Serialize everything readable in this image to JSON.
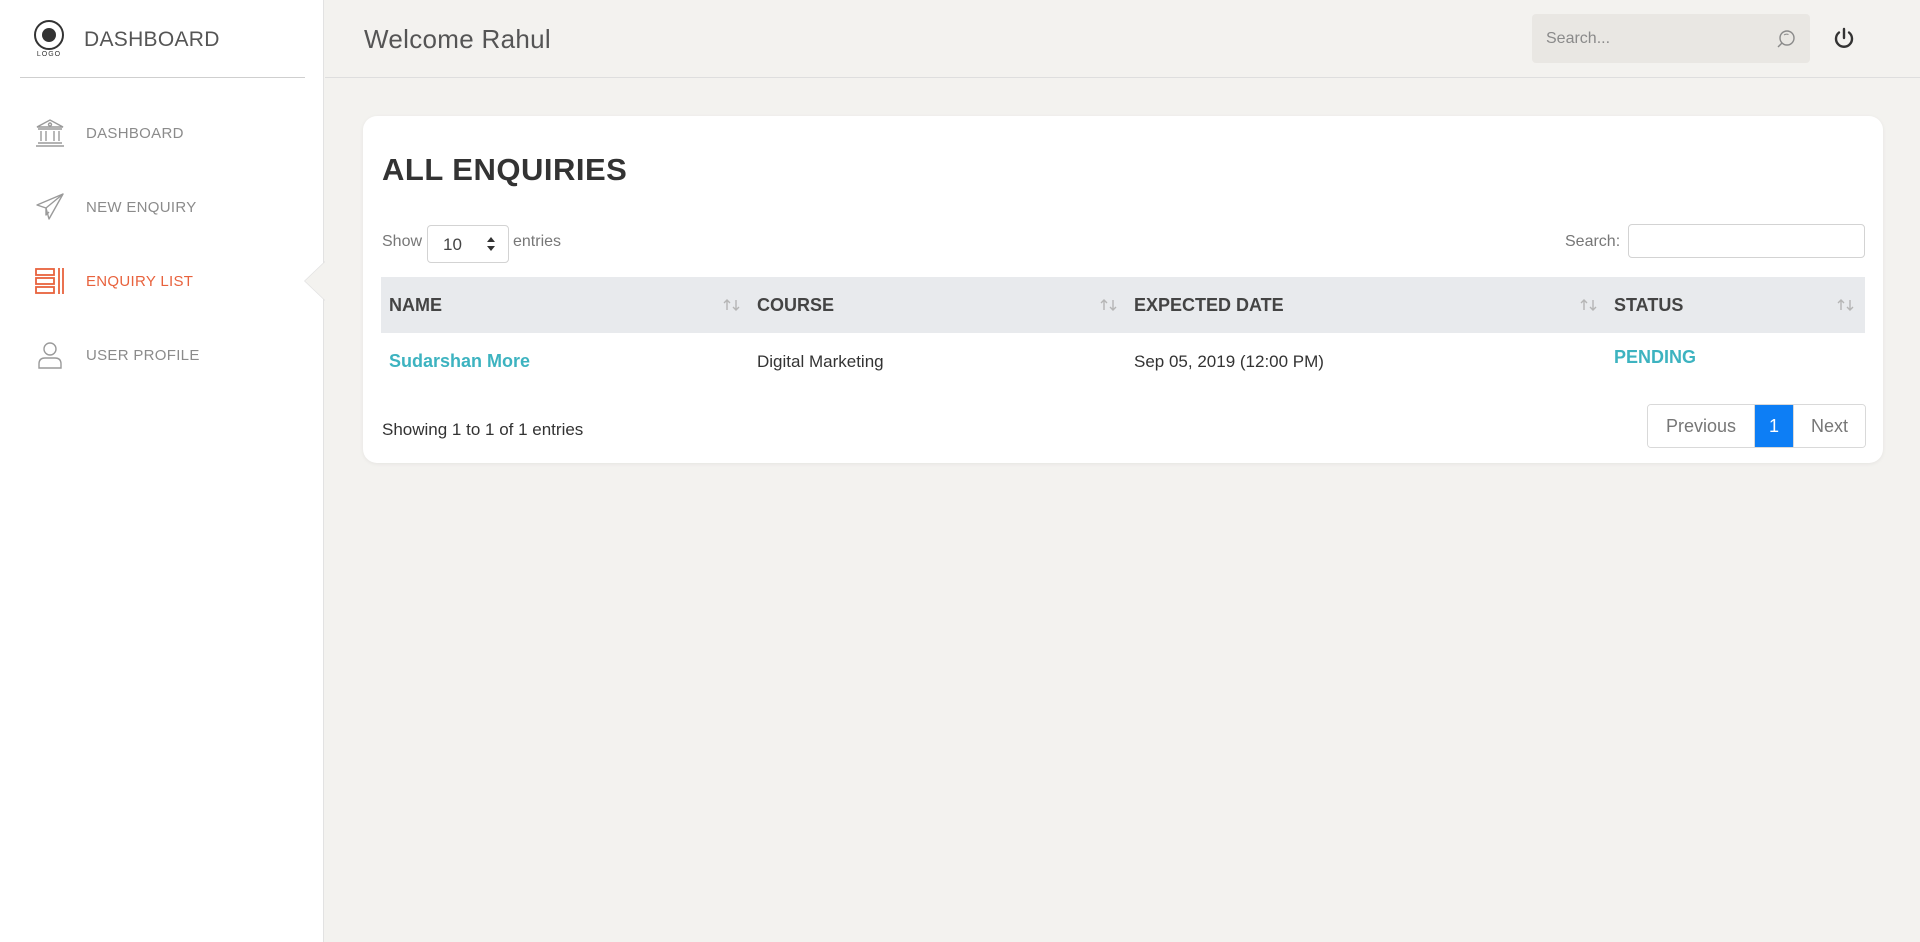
{
  "brand": {
    "logo_text": "LOGO",
    "title": "DASHBOARD"
  },
  "sidebar": {
    "items": [
      {
        "label": "DASHBOARD",
        "icon": "bank-icon",
        "active": false
      },
      {
        "label": "NEW ENQUIRY",
        "icon": "paper-plane-icon",
        "active": false
      },
      {
        "label": "ENQUIRY LIST",
        "icon": "list-icon",
        "active": true
      },
      {
        "label": "USER PROFILE",
        "icon": "user-icon",
        "active": false
      }
    ]
  },
  "header": {
    "welcome": "Welcome Rahul",
    "search_placeholder": "Search...",
    "search_icon": "search-icon",
    "power_icon": "power-icon"
  },
  "card": {
    "title": "ALL ENQUIRIES",
    "length": {
      "label_before": "Show",
      "value": "10",
      "label_after": "entries"
    },
    "search_label": "Search:",
    "columns": [
      "NAME",
      "COURSE",
      "EXPECTED DATE",
      "STATUS"
    ],
    "rows": [
      {
        "name": "Sudarshan More",
        "course": "Digital Marketing",
        "date": "Sep 05, 2019 (12:00 PM)",
        "status": "PENDING"
      }
    ],
    "info": "Showing 1 to 1 of 1 entries",
    "pagination": {
      "previous": "Previous",
      "current": "1",
      "next": "Next"
    }
  },
  "colors": {
    "accent": "#e8623d",
    "link": "#3db3c0",
    "primary": "#0d7ef5",
    "background": "#f3f2ef"
  }
}
